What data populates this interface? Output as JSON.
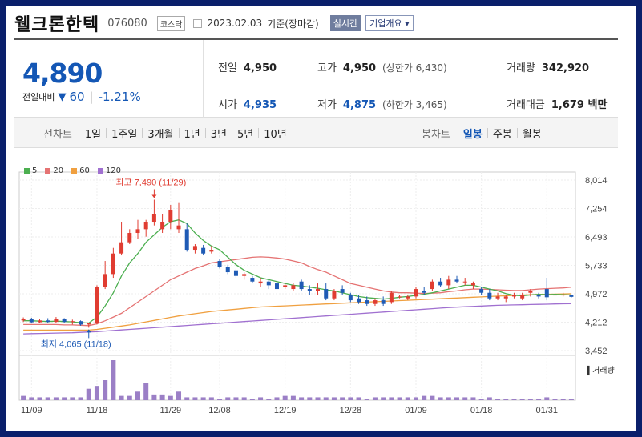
{
  "header": {
    "name": "웰크론한텍",
    "code": "076080",
    "market": "코스닥",
    "date": "2023.02.03",
    "basis": "기준(장마감)",
    "realtime": "실시간",
    "overview": "기업개요"
  },
  "quote": {
    "price": "4,890",
    "change_label": "전일대비",
    "change_arrow": "▼",
    "change": "60",
    "change_pct": "-1.21%",
    "prev_close_label": "전일",
    "prev_close": "4,950",
    "high_label": "고가",
    "high": "4,950",
    "upper_limit": "(상한가 6,430)",
    "volume_label": "거래량",
    "volume": "342,920",
    "open_label": "시가",
    "open": "4,935",
    "low_label": "저가",
    "low": "4,875",
    "lower_limit": "(하한가 3,465)",
    "amount_label": "거래대금",
    "amount": "1,679 백만"
  },
  "toolbar": {
    "line_label": "선차트",
    "periods": [
      "1일",
      "1주일",
      "3개월",
      "1년",
      "3년",
      "5년",
      "10년"
    ],
    "candle_label": "봉차트",
    "candle_periods": [
      "일봉",
      "주봉",
      "월봉"
    ],
    "active_candle": "일봉"
  },
  "colors": {
    "up": "#e03c31",
    "down": "#1f5bb5",
    "ma5": "#4caf50",
    "ma20": "#e57373",
    "ma60": "#f0a040",
    "ma120": "#a070d0"
  },
  "chart_data": {
    "type": "candlestick",
    "legend": [
      "5",
      "20",
      "60",
      "120"
    ],
    "y_ticks": [
      "8,014",
      "7,254",
      "6,493",
      "5,733",
      "4,972",
      "4,212",
      "3,452"
    ],
    "ylim": [
      3452,
      8014
    ],
    "x_ticks": [
      "11/09",
      "11/18",
      "11/29",
      "12/08",
      "12/19",
      "12/28",
      "01/09",
      "01/18",
      "01/31"
    ],
    "x_tick_index": [
      1,
      9,
      18,
      24,
      32,
      40,
      48,
      56,
      64
    ],
    "max_label": "최고 7,490 (11/29)",
    "min_label": "최저 4,065 (11/18)",
    "max_index": 16,
    "min_index": 8,
    "volume_label": "거래량",
    "ohlc": [
      [
        4260,
        4340,
        4220,
        4300
      ],
      [
        4300,
        4330,
        4180,
        4210
      ],
      [
        4210,
        4300,
        4190,
        4260
      ],
      [
        4260,
        4320,
        4200,
        4220
      ],
      [
        4220,
        4350,
        4200,
        4300
      ],
      [
        4300,
        4320,
        4180,
        4220
      ],
      [
        4220,
        4280,
        4150,
        4240
      ],
      [
        4240,
        4260,
        4120,
        4150
      ],
      [
        4150,
        4200,
        4065,
        4180
      ],
      [
        4180,
        5200,
        4150,
        5150
      ],
      [
        5150,
        5850,
        5100,
        5500
      ],
      [
        5500,
        6200,
        5400,
        6050
      ],
      [
        6050,
        6900,
        6000,
        6350
      ],
      [
        6350,
        6700,
        6300,
        6600
      ],
      [
        6600,
        6950,
        6450,
        6700
      ],
      [
        6700,
        6950,
        6500,
        6900
      ],
      [
        6900,
        7490,
        6800,
        7100
      ],
      [
        6700,
        7100,
        6600,
        6900
      ],
      [
        6900,
        7350,
        6700,
        7200
      ],
      [
        6700,
        7400,
        6600,
        6800
      ],
      [
        6700,
        6850,
        6100,
        6150
      ],
      [
        6150,
        6300,
        6050,
        6250
      ],
      [
        6200,
        6280,
        6000,
        6050
      ],
      [
        6100,
        6250,
        6050,
        6150
      ],
      [
        5850,
        5900,
        5650,
        5700
      ],
      [
        5700,
        5750,
        5500,
        5550
      ],
      [
        5600,
        5650,
        5400,
        5450
      ],
      [
        5450,
        5550,
        5350,
        5500
      ],
      [
        5400,
        5450,
        5250,
        5300
      ],
      [
        5250,
        5400,
        5150,
        5300
      ],
      [
        5300,
        5350,
        5100,
        5200
      ],
      [
        5250,
        5300,
        5000,
        5100
      ],
      [
        5150,
        5250,
        5100,
        5200
      ],
      [
        5100,
        5250,
        5050,
        5200
      ],
      [
        5300,
        5350,
        5050,
        5100
      ],
      [
        5100,
        5200,
        4950,
        5050
      ],
      [
        5050,
        5250,
        4950,
        5100
      ],
      [
        5100,
        5250,
        4800,
        4850
      ],
      [
        4850,
        5100,
        4800,
        5050
      ],
      [
        5100,
        5200,
        4950,
        5000
      ],
      [
        4950,
        5000,
        4750,
        4800
      ],
      [
        4850,
        4950,
        4700,
        4750
      ],
      [
        4800,
        4900,
        4650,
        4700
      ],
      [
        4700,
        4850,
        4650,
        4800
      ],
      [
        4800,
        4900,
        4650,
        4700
      ],
      [
        4750,
        5050,
        4700,
        5000
      ],
      [
        4900,
        4950,
        4850,
        4900
      ],
      [
        4850,
        4950,
        4800,
        4900
      ],
      [
        4900,
        5150,
        4850,
        5100
      ],
      [
        5050,
        5150,
        4950,
        5000
      ],
      [
        5100,
        5350,
        5050,
        5300
      ],
      [
        5300,
        5400,
        5150,
        5200
      ],
      [
        5200,
        5450,
        5100,
        5350
      ],
      [
        5350,
        5450,
        5250,
        5300
      ],
      [
        5300,
        5400,
        5200,
        5300
      ],
      [
        5200,
        5300,
        5100,
        5250
      ],
      [
        5100,
        5150,
        4950,
        5000
      ],
      [
        5000,
        5100,
        4800,
        4850
      ],
      [
        4850,
        5000,
        4800,
        4900
      ],
      [
        4850,
        4950,
        4750,
        4900
      ],
      [
        4900,
        5000,
        4850,
        4950
      ],
      [
        4850,
        5000,
        4800,
        4950
      ],
      [
        5000,
        5100,
        4900,
        5050
      ],
      [
        4950,
        5000,
        4850,
        4900
      ],
      [
        5100,
        5400,
        4800,
        4880
      ],
      [
        4950,
        5000,
        4900,
        4950
      ],
      [
        4950,
        5000,
        4900,
        4950
      ],
      [
        4935,
        4950,
        4875,
        4890
      ]
    ],
    "volume": [
      3,
      2,
      2,
      2,
      2,
      2,
      2,
      2,
      8,
      10,
      14,
      28,
      3,
      3,
      6,
      12,
      4,
      4,
      3,
      6,
      2,
      2,
      2,
      2,
      1,
      2,
      2,
      2,
      1,
      2,
      1,
      2,
      3,
      3,
      2,
      2,
      2,
      2,
      2,
      2,
      2,
      2,
      1,
      2,
      2,
      2,
      2,
      2,
      2,
      3,
      3,
      2,
      2,
      2,
      2,
      2,
      1,
      2,
      1,
      1,
      1,
      1,
      1,
      1,
      2,
      1,
      1,
      1
    ],
    "ma5": [
      4250,
      4250,
      4240,
      4230,
      4240,
      4230,
      4220,
      4200,
      4190,
      4350,
      4650,
      5000,
      5450,
      5800,
      6050,
      6350,
      6550,
      6750,
      6900,
      6950,
      6850,
      6600,
      6400,
      6250,
      6150,
      5950,
      5750,
      5600,
      5500,
      5400,
      5350,
      5300,
      5250,
      5200,
      5180,
      5150,
      5120,
      5080,
      5050,
      5000,
      4950,
      4900,
      4870,
      4850,
      4830,
      4850,
      4880,
      4900,
      4930,
      4960,
      5000,
      5050,
      5100,
      5150,
      5200,
      5200,
      5150,
      5100,
      5050,
      4980,
      4930,
      4920,
      4940,
      4960,
      4950,
      4960,
      4950,
      4940
    ],
    "ma20": [
      4150,
      4150,
      4150,
      4150,
      4150,
      4140,
      4140,
      4130,
      4120,
      4170,
      4250,
      4350,
      4450,
      4600,
      4750,
      4900,
      5050,
      5200,
      5350,
      5450,
      5550,
      5650,
      5720,
      5800,
      5830,
      5860,
      5890,
      5920,
      5950,
      5960,
      5950,
      5930,
      5900,
      5850,
      5800,
      5700,
      5620,
      5550,
      5450,
      5350,
      5250,
      5200,
      5150,
      5100,
      5050,
      5020,
      5000,
      5000,
      4990,
      4980,
      4990,
      5000,
      5030,
      5050,
      5080,
      5100,
      5100,
      5090,
      5080,
      5070,
      5060,
      5060,
      5080,
      5100,
      5110,
      5120,
      5130,
      5150
    ],
    "ma60": [
      4000,
      4000,
      4000,
      4000,
      4000,
      4000,
      4000,
      4000,
      4000,
      4020,
      4050,
      4080,
      4110,
      4140,
      4180,
      4220,
      4260,
      4300,
      4340,
      4380,
      4410,
      4440,
      4470,
      4500,
      4520,
      4540,
      4560,
      4580,
      4600,
      4620,
      4630,
      4640,
      4650,
      4660,
      4670,
      4680,
      4690,
      4700,
      4710,
      4720,
      4730,
      4740,
      4750,
      4760,
      4770,
      4780,
      4790,
      4800,
      4810,
      4820,
      4830,
      4840,
      4850,
      4860,
      4870,
      4880,
      4890,
      4900,
      4910,
      4920,
      4930,
      4940,
      4950,
      4955,
      4960,
      4965,
      4970,
      4975
    ],
    "ma120": [
      3900,
      3905,
      3910,
      3915,
      3920,
      3925,
      3930,
      3940,
      3950,
      3960,
      3975,
      3990,
      4005,
      4020,
      4035,
      4050,
      4065,
      4080,
      4095,
      4110,
      4125,
      4140,
      4155,
      4170,
      4185,
      4200,
      4215,
      4230,
      4245,
      4260,
      4275,
      4290,
      4305,
      4320,
      4335,
      4350,
      4365,
      4380,
      4395,
      4410,
      4425,
      4440,
      4455,
      4470,
      4485,
      4500,
      4515,
      4530,
      4545,
      4560,
      4575,
      4590,
      4605,
      4615,
      4625,
      4635,
      4645,
      4655,
      4665,
      4670,
      4675,
      4680,
      4685,
      4690,
      4695,
      4700,
      4705,
      4710
    ]
  }
}
